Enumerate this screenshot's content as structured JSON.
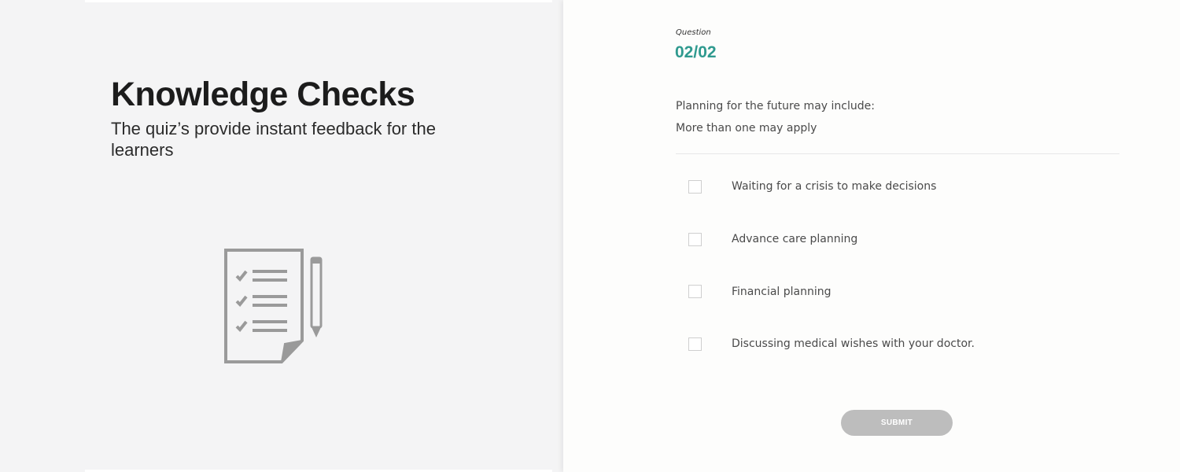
{
  "intro": {
    "title": "Knowledge Checks",
    "subtitle": "The quiz’s provide instant feedback for the learners",
    "illustration_icon": "checklist-with-pencil-icon"
  },
  "quiz": {
    "question_label": "Question",
    "counter": "02/02",
    "prompt": "Planning for the future may include:",
    "hint": "More than one may apply",
    "options": [
      {
        "label": "Waiting for a crisis to make decisions",
        "checked": false
      },
      {
        "label": "Advance care planning",
        "checked": false
      },
      {
        "label": "Financial planning",
        "checked": false
      },
      {
        "label": "Discussing medical wishes with your doctor.",
        "checked": false
      }
    ],
    "submit_label": "SUBMIT"
  },
  "colors": {
    "accent": "#2f9a8f",
    "left_background": "#f4f4f5",
    "right_background": "#fdfdfc",
    "submit_disabled": "#bdbdbd",
    "icon_gray": "#9a9a9a"
  }
}
